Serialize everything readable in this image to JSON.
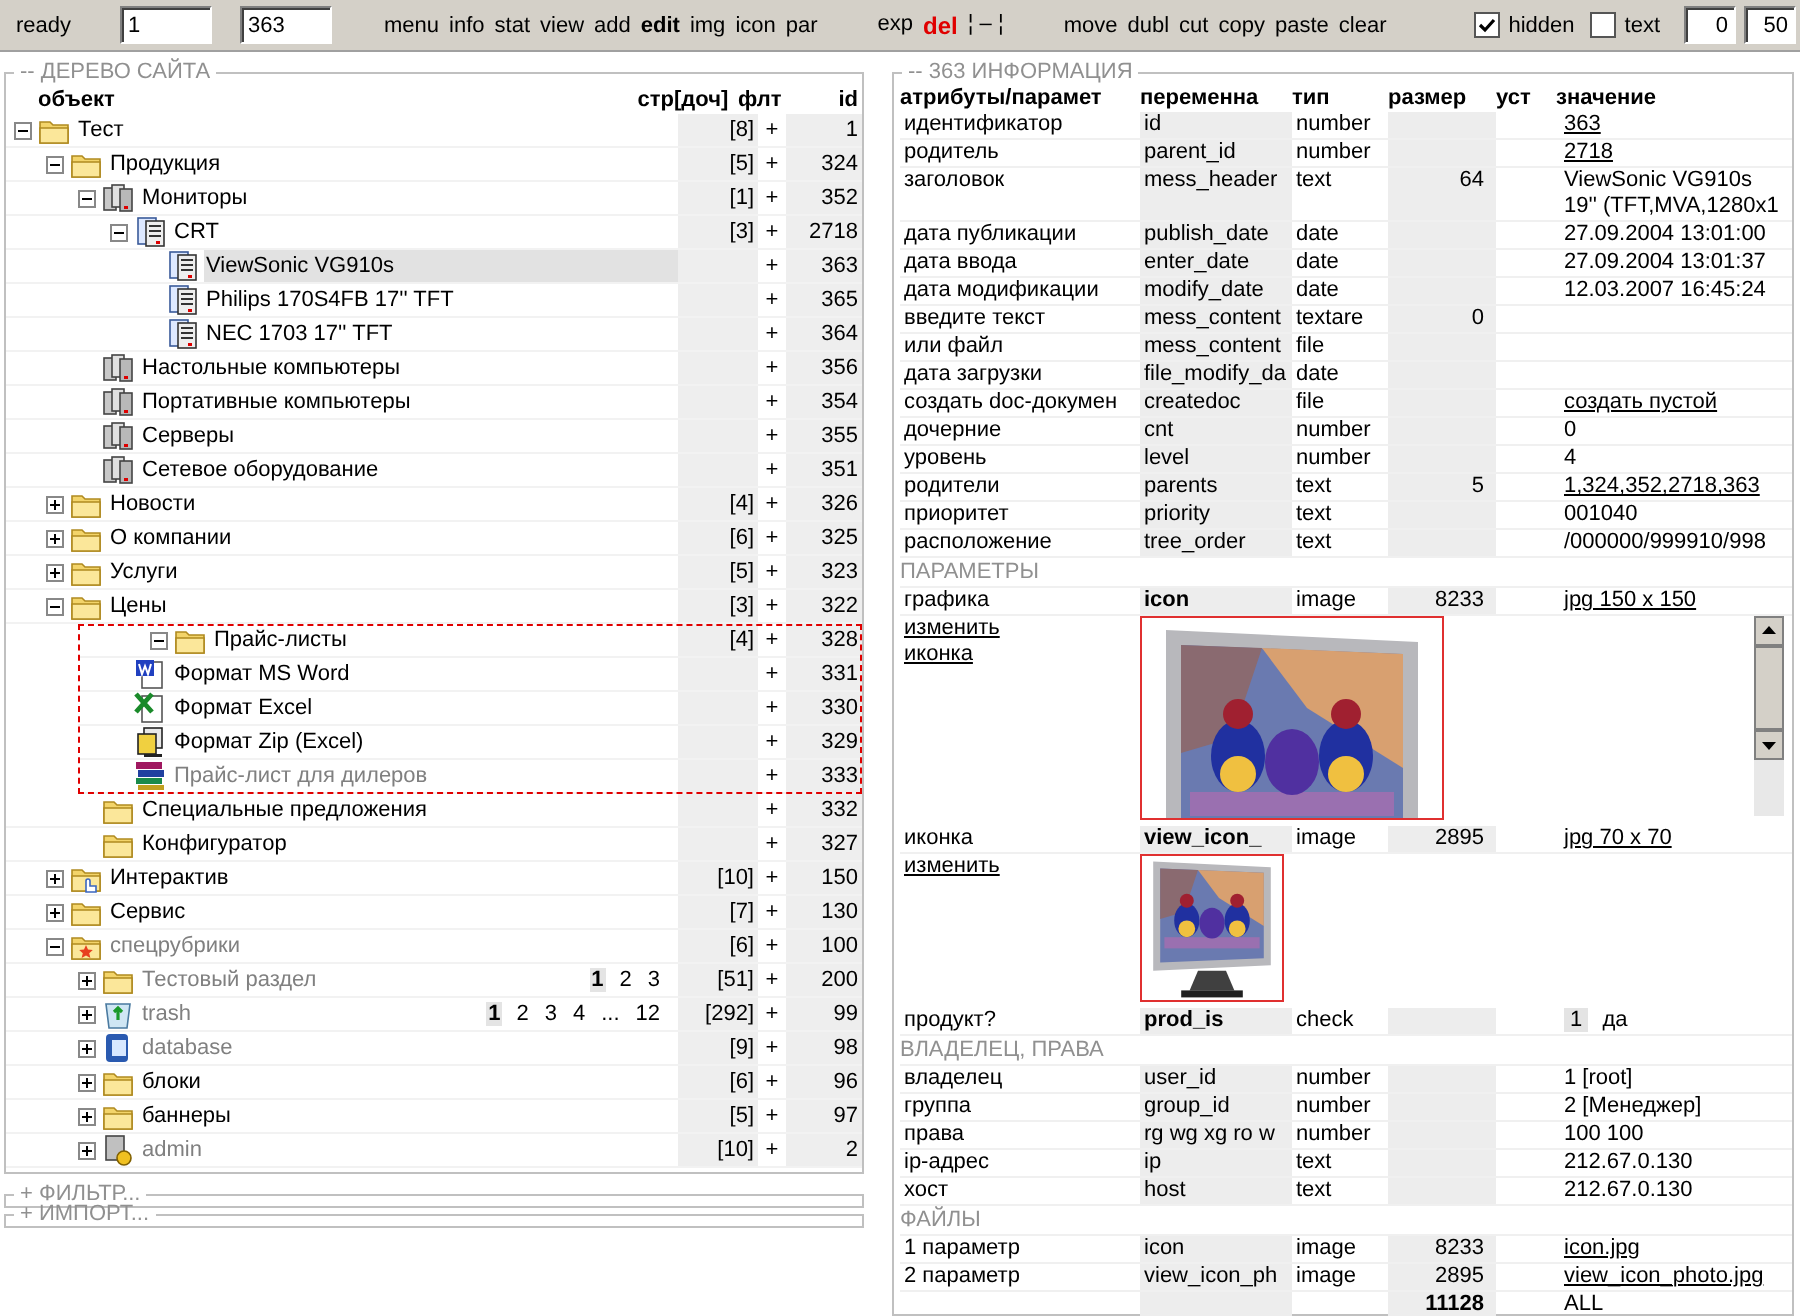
{
  "toolbar": {
    "status": "ready",
    "fields": [
      {
        "value": "1"
      },
      {
        "value": "363"
      }
    ],
    "link_groups": [
      {
        "links": [
          {
            "label": "menu",
            "kind": "plain"
          },
          {
            "label": "info",
            "kind": "plain"
          },
          {
            "label": "stat",
            "kind": "plain"
          },
          {
            "label": "view",
            "kind": "plain"
          },
          {
            "label": "add",
            "kind": "plain"
          },
          {
            "label": "edit",
            "kind": "active"
          },
          {
            "label": "img",
            "kind": "plain"
          },
          {
            "label": "icon",
            "kind": "plain"
          },
          {
            "label": "par",
            "kind": "plain"
          }
        ]
      },
      {
        "links": [
          {
            "label": "exp",
            "kind": "plain"
          },
          {
            "label": "del",
            "kind": "danger"
          },
          {
            "label": "¦ – ¦",
            "kind": "separator"
          }
        ]
      },
      {
        "links": [
          {
            "label": "move",
            "kind": "plain"
          },
          {
            "label": "dubl",
            "kind": "plain"
          },
          {
            "label": "cut",
            "kind": "plain"
          },
          {
            "label": "copy",
            "kind": "plain"
          },
          {
            "label": "paste",
            "kind": "plain"
          },
          {
            "label": "clear",
            "kind": "plain"
          }
        ]
      }
    ],
    "options": [
      {
        "label": "hidden",
        "checked": true
      },
      {
        "label": "text",
        "checked": false
      }
    ],
    "range": [
      {
        "value": "0"
      },
      {
        "value": "50"
      }
    ]
  },
  "tree": {
    "title": "-- ДЕРЕВО САЙТА",
    "columns": [
      "объект",
      "стр",
      "[доч]",
      "флт",
      "id"
    ],
    "nodes": [
      {
        "label": "Тест",
        "kind": "folder",
        "expanded": true,
        "count": "[8]",
        "flag": "+",
        "id": "1",
        "selected": false,
        "dimmed": false,
        "marked": false,
        "children": [
          {
            "label": "Продукция",
            "kind": "folder",
            "expanded": true,
            "count": "[5]",
            "flag": "+",
            "id": "324",
            "selected": false,
            "dimmed": false,
            "marked": false,
            "children": [
              {
                "label": "Мониторы",
                "kind": "servers",
                "expanded": true,
                "count": "[1]",
                "flag": "+",
                "id": "352",
                "selected": false,
                "dimmed": false,
                "marked": false,
                "children": [
                  {
                    "label": "CRT",
                    "kind": "pages",
                    "expanded": true,
                    "count": "[3]",
                    "flag": "+",
                    "id": "2718",
                    "selected": false,
                    "dimmed": false,
                    "marked": false,
                    "children": [
                      {
                        "label": "ViewSonic VG910s",
                        "kind": "pages",
                        "flag": "+",
                        "id": "363",
                        "selected": true,
                        "dimmed": false,
                        "marked": false
                      },
                      {
                        "label": "Philips 170S4FB 17'' TFT",
                        "kind": "pages",
                        "flag": "+",
                        "id": "365",
                        "selected": false,
                        "dimmed": false,
                        "marked": false
                      },
                      {
                        "label": "NEC 1703 17'' TFT",
                        "kind": "pages",
                        "flag": "+",
                        "id": "364",
                        "selected": false,
                        "dimmed": false,
                        "marked": false
                      }
                    ]
                  }
                ]
              },
              {
                "label": "Настольные компьютеры",
                "kind": "servers",
                "flag": "+",
                "id": "356",
                "selected": false,
                "dimmed": false,
                "marked": false
              },
              {
                "label": "Портативные компьютеры",
                "kind": "servers",
                "flag": "+",
                "id": "354",
                "selected": false,
                "dimmed": false,
                "marked": false
              },
              {
                "label": "Серверы",
                "kind": "servers",
                "flag": "+",
                "id": "355",
                "selected": false,
                "dimmed": false,
                "marked": false
              },
              {
                "label": "Сетевое оборудование",
                "kind": "servers",
                "flag": "+",
                "id": "351",
                "selected": false,
                "dimmed": false,
                "marked": false
              }
            ]
          },
          {
            "label": "Новости",
            "kind": "folder",
            "expanded": false,
            "count": "[4]",
            "flag": "+",
            "id": "326",
            "selected": false,
            "dimmed": false,
            "marked": false
          },
          {
            "label": "О компании",
            "kind": "folder",
            "expanded": false,
            "count": "[6]",
            "flag": "+",
            "id": "325",
            "selected": false,
            "dimmed": false,
            "marked": false
          },
          {
            "label": "Услуги",
            "kind": "folder",
            "expanded": false,
            "count": "[5]",
            "flag": "+",
            "id": "323",
            "selected": false,
            "dimmed": false,
            "marked": false
          },
          {
            "label": "Цены",
            "kind": "folder",
            "expanded": true,
            "count": "[3]",
            "flag": "+",
            "id": "322",
            "selected": false,
            "dimmed": false,
            "marked": false,
            "children": [
              {
                "label": "Прайс-листы",
                "kind": "folder",
                "expanded": true,
                "count": "[4]",
                "flag": "+",
                "id": "328",
                "selected": false,
                "dimmed": false,
                "marked": true,
                "children": [
                  {
                    "label": "Формат MS Word",
                    "kind": "word",
                    "flag": "+",
                    "id": "331",
                    "selected": false,
                    "dimmed": false,
                    "marked": false
                  },
                  {
                    "label": "Формат Excel",
                    "kind": "excel",
                    "flag": "+",
                    "id": "330",
                    "selected": false,
                    "dimmed": false,
                    "marked": false
                  },
                  {
                    "label": "Формат Zip (Excel)",
                    "kind": "zip",
                    "flag": "+",
                    "id": "329",
                    "selected": false,
                    "dimmed": false,
                    "marked": false
                  },
                  {
                    "label": "Прайс-лист для дилеров",
                    "kind": "books",
                    "flag": "+",
                    "id": "333",
                    "selected": false,
                    "dimmed": true,
                    "marked": false
                  }
                ]
              },
              {
                "label": "Специальные предложения",
                "kind": "folder",
                "flag": "+",
                "id": "332",
                "selected": false,
                "dimmed": false,
                "marked": false
              },
              {
                "label": "Конфигуратор",
                "kind": "folder",
                "flag": "+",
                "id": "327",
                "selected": false,
                "dimmed": false,
                "marked": false
              }
            ]
          },
          {
            "label": "Интерактив",
            "kind": "hand-folder",
            "expanded": false,
            "count": "[10]",
            "flag": "+",
            "id": "150",
            "selected": false,
            "dimmed": false,
            "marked": false
          },
          {
            "label": "Сервис",
            "kind": "folder",
            "expanded": false,
            "count": "[7]",
            "flag": "+",
            "id": "130",
            "selected": false,
            "dimmed": false,
            "marked": false
          },
          {
            "label": "спецрубрики",
            "kind": "star-folder",
            "expanded": true,
            "count": "[6]",
            "flag": "+",
            "id": "100",
            "selected": false,
            "dimmed": true,
            "marked": false,
            "children": [
              {
                "label": "Тестовый раздел",
                "kind": "folder",
                "expanded": false,
                "pages": [
                  {
                    "label": "1",
                    "selected": true
                  },
                  {
                    "label": "2",
                    "selected": false
                  },
                  {
                    "label": "3",
                    "selected": false
                  }
                ],
                "count": "[51]",
                "flag": "+",
                "id": "200",
                "selected": false,
                "dimmed": true,
                "marked": false
              },
              {
                "label": "trash",
                "kind": "trash",
                "expanded": false,
                "pages": [
                  {
                    "label": "1",
                    "selected": true
                  },
                  {
                    "label": "2",
                    "selected": false
                  },
                  {
                    "label": "3",
                    "selected": false
                  },
                  {
                    "label": "4",
                    "selected": false
                  },
                  {
                    "label": "...",
                    "selected": false
                  },
                  {
                    "label": "12",
                    "selected": false
                  }
                ],
                "count": "[292]",
                "flag": "+",
                "id": "99",
                "selected": false,
                "dimmed": true,
                "marked": false
              },
              {
                "label": "database",
                "kind": "database",
                "expanded": false,
                "count": "[9]",
                "flag": "+",
                "id": "98",
                "selected": false,
                "dimmed": true,
                "marked": false
              },
              {
                "label": "блоки",
                "kind": "folder",
                "expanded": false,
                "count": "[6]",
                "flag": "+",
                "id": "96",
                "selected": false,
                "dimmed": false,
                "marked": false
              },
              {
                "label": "баннеры",
                "kind": "folder",
                "expanded": false,
                "count": "[5]",
                "flag": "+",
                "id": "97",
                "selected": false,
                "dimmed": false,
                "marked": false
              },
              {
                "label": "admin",
                "kind": "admin",
                "expanded": false,
                "count": "[10]",
                "flag": "+",
                "id": "2",
                "selected": false,
                "dimmed": true,
                "marked": false
              }
            ]
          }
        ]
      }
    ]
  },
  "collapsed_panels": [
    {
      "title": "+ ФИЛЬТР..."
    },
    {
      "title": "+ ИМПОРТ..."
    }
  ],
  "info": {
    "title": "-- 363 ИНФОРМАЦИЯ",
    "columns": [
      "атрибуты/парамет",
      "переменна",
      "тип",
      "размер",
      "уст",
      "значение"
    ],
    "rows": [
      {
        "kind": "field",
        "label": "идентификатор",
        "variable": "id",
        "type": "number",
        "value": "363",
        "link": true
      },
      {
        "kind": "field",
        "label": "родитель",
        "variable": "parent_id",
        "type": "number",
        "value": "2718",
        "link": true
      },
      {
        "kind": "field",
        "label": "заголовок",
        "variable": "mess_header",
        "type": "text",
        "size": "64",
        "value_lines": [
          "ViewSonic VG910s",
          "19'' (TFT,MVA,1280x1"
        ],
        "link": false
      },
      {
        "kind": "field",
        "label": "дата публикации",
        "variable": "publish_date",
        "type": "date",
        "value": "27.09.2004 13:01:00",
        "link": false
      },
      {
        "kind": "field",
        "label": "дата ввода",
        "variable": "enter_date",
        "type": "date",
        "value": "27.09.2004 13:01:37",
        "link": false
      },
      {
        "kind": "field",
        "label": "дата модификации",
        "variable": "modify_date",
        "type": "date",
        "value": "12.03.2007 16:45:24",
        "link": false
      },
      {
        "kind": "field",
        "label": "введите текст",
        "variable": "mess_content",
        "type": "textare",
        "size": "0"
      },
      {
        "kind": "field",
        "label": "или файл",
        "variable": "mess_content",
        "type": "file"
      },
      {
        "kind": "field",
        "label": "дата загрузки",
        "variable": "file_modify_da",
        "type": "date"
      },
      {
        "kind": "field",
        "label": "создать doc-докумен",
        "variable": "createdoc",
        "type": "file",
        "value": "создать пустой",
        "link": true
      },
      {
        "kind": "field",
        "label": "дочерние",
        "variable": "cnt",
        "type": "number",
        "value": "0",
        "link": false
      },
      {
        "kind": "field",
        "label": "уровень",
        "variable": "level",
        "type": "number",
        "value": "4",
        "link": false
      },
      {
        "kind": "field",
        "label": "родители",
        "variable": "parents",
        "type": "text",
        "size": "5",
        "value": "1,324,352,2718,363",
        "link": true
      },
      {
        "kind": "field",
        "label": "приоритет",
        "variable": "priority",
        "type": "text",
        "value": "001040",
        "link": false
      },
      {
        "kind": "field",
        "label": "расположение",
        "variable": "tree_order",
        "type": "text",
        "value": "/000000/999910/998",
        "link": false
      },
      {
        "kind": "section",
        "label": "ПАРАМЕТРЫ"
      },
      {
        "label": "графика",
        "variable": "icon",
        "type": "image",
        "size": "8233",
        "value": "jpg 150 x 150",
        "link": true,
        "actions": [
          "изменить",
          "иконка"
        ],
        "scrollable": true
      },
      {
        "label": "иконка",
        "variable": "view_icon_",
        "type": "image",
        "size": "2895",
        "value": "jpg 70 x 70",
        "link": true,
        "actions": [
          "изменить"
        ],
        "scrollable": false
      },
      {
        "kind": "check",
        "label": "продукт?",
        "variable": "prod_is",
        "type": "check",
        "badge": "1",
        "value": "да"
      },
      {
        "kind": "section",
        "label": "ВЛАДЕЛЕЦ, ПРАВА"
      },
      {
        "kind": "field",
        "label": "владелец",
        "variable": "user_id",
        "type": "number",
        "value": "1 [root]",
        "link": false
      },
      {
        "kind": "field",
        "label": "группа",
        "variable": "group_id",
        "type": "number",
        "value": "2 [Менеджер]",
        "link": false
      },
      {
        "kind": "field",
        "label": "права",
        "variable": "rg wg xg ro w",
        "type": "number",
        "value": "100 100",
        "link": false
      },
      {
        "kind": "field",
        "label": "ip-адрес",
        "variable": "ip",
        "type": "text",
        "value": "212.67.0.130",
        "link": false
      },
      {
        "kind": "field",
        "label": "хост",
        "variable": "host",
        "type": "text",
        "value": "212.67.0.130",
        "link": false
      },
      {
        "kind": "section",
        "label": "ФАЙЛЫ"
      },
      {
        "kind": "field",
        "label": "1 параметр",
        "variable": "icon",
        "type": "image",
        "size": "8233",
        "value": "icon.jpg",
        "link": true
      },
      {
        "kind": "field",
        "label": "2 параметр",
        "variable": "view_icon_ph",
        "type": "image",
        "size": "2895",
        "value": "view_icon_photo.jpg",
        "link": true
      },
      {
        "kind": "total",
        "size": "11128",
        "value": "ALL"
      }
    ]
  }
}
